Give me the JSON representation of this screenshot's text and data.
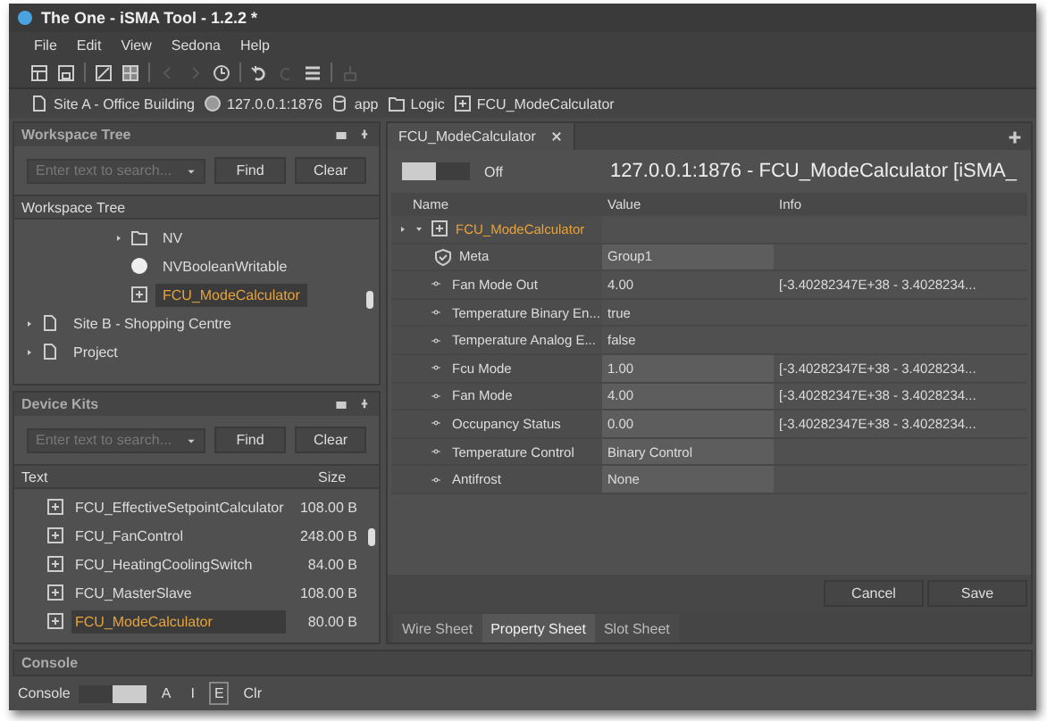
{
  "window": {
    "title": "The One - iSMA Tool - 1.2.2 *"
  },
  "menu": [
    "File",
    "Edit",
    "View",
    "Sedona",
    "Help"
  ],
  "toolbar": [
    {
      "disabled": false
    },
    {
      "disabled": false
    },
    {
      "disabled": false
    },
    {
      "disabled": false
    },
    {
      "disabled": true
    },
    {
      "disabled": true
    },
    {
      "disabled": false
    },
    {
      "disabled": false
    },
    {
      "disabled": true
    },
    {
      "disabled": false
    },
    {
      "disabled": true
    }
  ],
  "breadcrumb": [
    {
      "kind": "page",
      "label": "Site A - Office Building"
    },
    {
      "kind": "device",
      "label": "127.0.0.1:1876"
    },
    {
      "kind": "db",
      "label": "app"
    },
    {
      "kind": "folder",
      "label": "Logic"
    },
    {
      "kind": "component",
      "label": "FCU_ModeCalculator"
    }
  ],
  "workspace_tree": {
    "title": "Workspace Tree",
    "search": {
      "placeholder": "Enter text to search..."
    },
    "buttons": [
      "Find",
      "Clear"
    ],
    "column": "Workspace Tree",
    "items": [
      {
        "kind": "folder",
        "label": "NV",
        "expandable": true,
        "selected": false
      },
      {
        "kind": "boolean",
        "label": "NVBooleanWritable",
        "expandable": false,
        "selected": false
      },
      {
        "kind": "component",
        "label": "FCU_ModeCalculator",
        "expandable": false,
        "selected": true
      }
    ],
    "roots": [
      {
        "kind": "page",
        "label": "Site B - Shopping Centre",
        "expandable": true,
        "selected": false
      },
      {
        "kind": "page",
        "label": "Project",
        "expandable": true,
        "selected": false
      }
    ]
  },
  "device_kits": {
    "title": "Device Kits",
    "search": {
      "placeholder": "Enter text to search..."
    },
    "buttons": [
      "Find",
      "Clear"
    ],
    "columns": [
      "Text",
      "Size"
    ],
    "rows": [
      {
        "name": "FCU_EffectiveSetpointCalculator",
        "size": "108.00 B",
        "selected": false
      },
      {
        "name": "FCU_FanControl",
        "size": "248.00 B",
        "selected": false
      },
      {
        "name": "FCU_HeatingCoolingSwitch",
        "size": "84.00 B",
        "selected": false
      },
      {
        "name": "FCU_MasterSlave",
        "size": "108.00 B",
        "selected": false
      },
      {
        "name": "FCU_ModeCalculator",
        "size": "80.00 B",
        "selected": true
      }
    ]
  },
  "editor": {
    "tab": "FCU_ModeCalculator",
    "toggle": {
      "on": false,
      "label": "Off"
    },
    "heading": "127.0.0.1:1876 - FCU_ModeCalculator [iSMA_",
    "columns": [
      "Name",
      "Value",
      "Info"
    ],
    "component": {
      "name": "FCU_ModeCalculator",
      "expanded": true
    },
    "rows": [
      {
        "kind": "meta",
        "name": "Meta",
        "value": "Group1",
        "editable": true
      },
      {
        "kind": "slot",
        "name": "Fan Mode Out",
        "value": "4.00",
        "info": "[-3.40282347E+38 - 3.4028234...",
        "editable": false
      },
      {
        "kind": "slot",
        "name": "Temperature Binary En...",
        "value": "true",
        "editable": false
      },
      {
        "kind": "slot",
        "name": "Temperature Analog E...",
        "value": "false",
        "editable": false
      },
      {
        "kind": "slot",
        "name": "Fcu Mode",
        "value": "1.00",
        "info": "[-3.40282347E+38 - 3.4028234...",
        "editable": true
      },
      {
        "kind": "slot",
        "name": "Fan Mode",
        "value": "4.00",
        "info": "[-3.40282347E+38 - 3.4028234...",
        "editable": true
      },
      {
        "kind": "slot",
        "name": "Occupancy Status",
        "value": "0.00",
        "info": "[-3.40282347E+38 - 3.4028234...",
        "editable": true
      },
      {
        "kind": "slot",
        "name": "Temperature Control",
        "value": "Binary Control",
        "editable": true
      },
      {
        "kind": "slot",
        "name": "Antifrost",
        "value": "None",
        "editable": true
      }
    ],
    "buttons": [
      "Cancel",
      "Save"
    ],
    "views": [
      {
        "label": "Wire Sheet",
        "selected": false
      },
      {
        "label": "Property Sheet",
        "selected": true
      },
      {
        "label": "Slot Sheet",
        "selected": false
      }
    ]
  },
  "console": {
    "title": "Console",
    "label": "Console",
    "toggle": {
      "on": true
    },
    "filters": [
      {
        "label": "A",
        "selected": false
      },
      {
        "label": "I",
        "selected": false
      },
      {
        "label": "E",
        "selected": true
      }
    ],
    "clear": "Clr"
  }
}
